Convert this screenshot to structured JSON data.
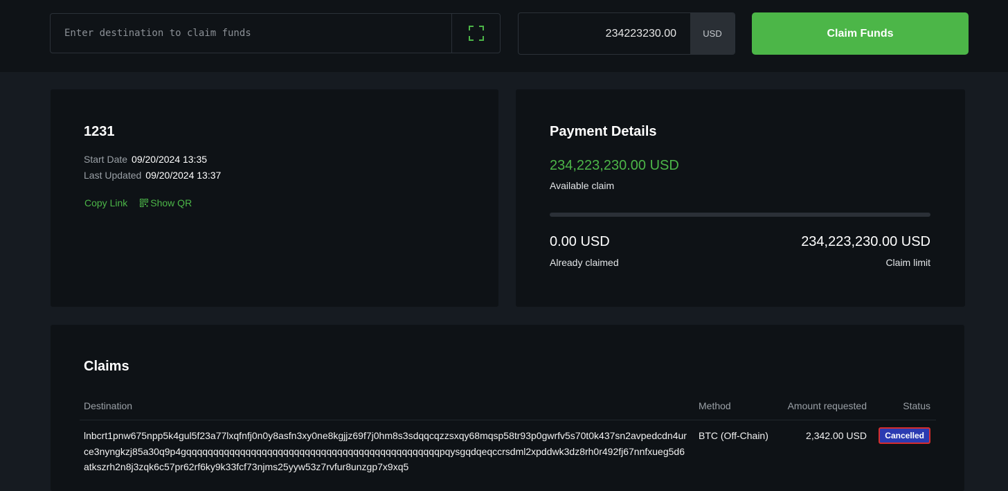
{
  "topbar": {
    "destination": {
      "placeholder": "Enter destination to claim funds",
      "value": ""
    },
    "scan_icon": "qr-scan-icon",
    "amount": {
      "value": "234223230.00",
      "currency": "USD"
    },
    "claim_button": "Claim Funds"
  },
  "summary": {
    "id": "1231",
    "start_date_label": "Start Date",
    "start_date": "09/20/2024 13:35",
    "last_updated_label": "Last Updated",
    "last_updated": "09/20/2024 13:37",
    "copy_link": "Copy Link",
    "show_qr": "Show QR"
  },
  "payment": {
    "title": "Payment Details",
    "available": "234,223,230.00 USD",
    "available_label": "Available claim",
    "claimed_fraction": 0.0,
    "already_claimed": "0.00 USD",
    "already_claimed_label": "Already claimed",
    "limit": "234,223,230.00 USD",
    "limit_label": "Claim limit"
  },
  "claims": {
    "title": "Claims",
    "columns": [
      "Destination",
      "Method",
      "Amount requested",
      "Status"
    ],
    "rows": [
      {
        "destination": "lnbcrt1pnw675npp5k4gul5f23a77lxqfnfj0n0y8asfn3xy0ne8kgjjz69f7j0hm8s3sdqqcqzzsxqy68mqsp58tr93p0gwrfv5s70t0k437sn2avpedcdn4urce3nyngkzj85a30q9p4gqqqqqqqqqqqqqqqqqqqqqqqqqqqqqqqqqqqqqqqqqqqqqqqpqysgqdqeqccrsdml2xpddwk3dz8rh0r492fj67nnfxueg5d6atkszrh2n8j3zqk6c57pr62rf6ky9k33fcf73njms25yyw53z7rvfur8unzgp7x9xq5",
        "method": "BTC (Off-Chain)",
        "amount": "2,342.00 USD",
        "status": "Cancelled"
      }
    ]
  },
  "colors": {
    "accent": "#4cb648",
    "badge_bg": "#2b3bb2",
    "badge_border": "#d62d2d"
  }
}
